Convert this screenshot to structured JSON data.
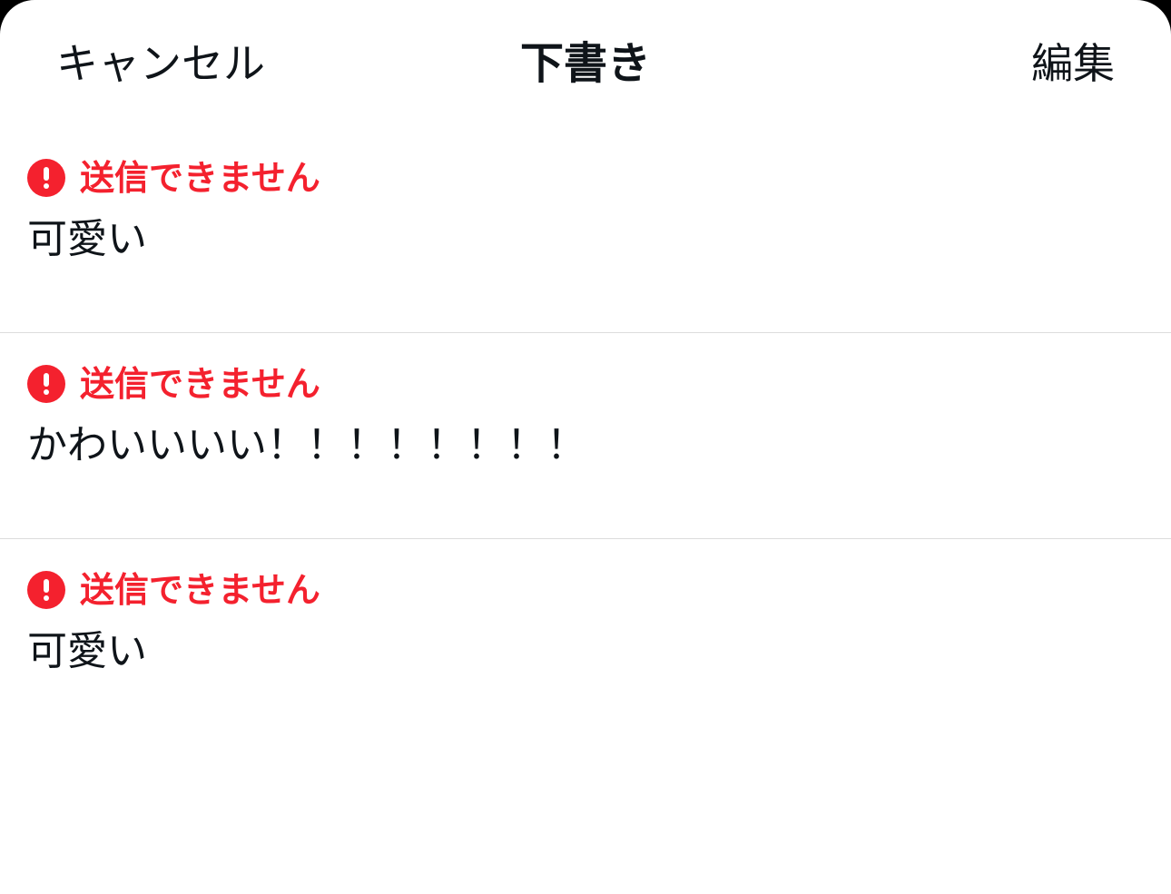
{
  "colors": {
    "error": "#f4212e",
    "text": "#0f1419",
    "background": "#ffffff",
    "divider": "#dcdcdc"
  },
  "header": {
    "cancel_label": "キャンセル",
    "title": "下書き",
    "edit_label": "編集"
  },
  "drafts": [
    {
      "status": "送信できません",
      "status_icon": "error-exclamation-icon",
      "text": "可愛い"
    },
    {
      "status": "送信できません",
      "status_icon": "error-exclamation-icon",
      "text": "かわいいいい！！！！！！！！"
    },
    {
      "status": "送信できません",
      "status_icon": "error-exclamation-icon",
      "text": "可愛い"
    }
  ]
}
